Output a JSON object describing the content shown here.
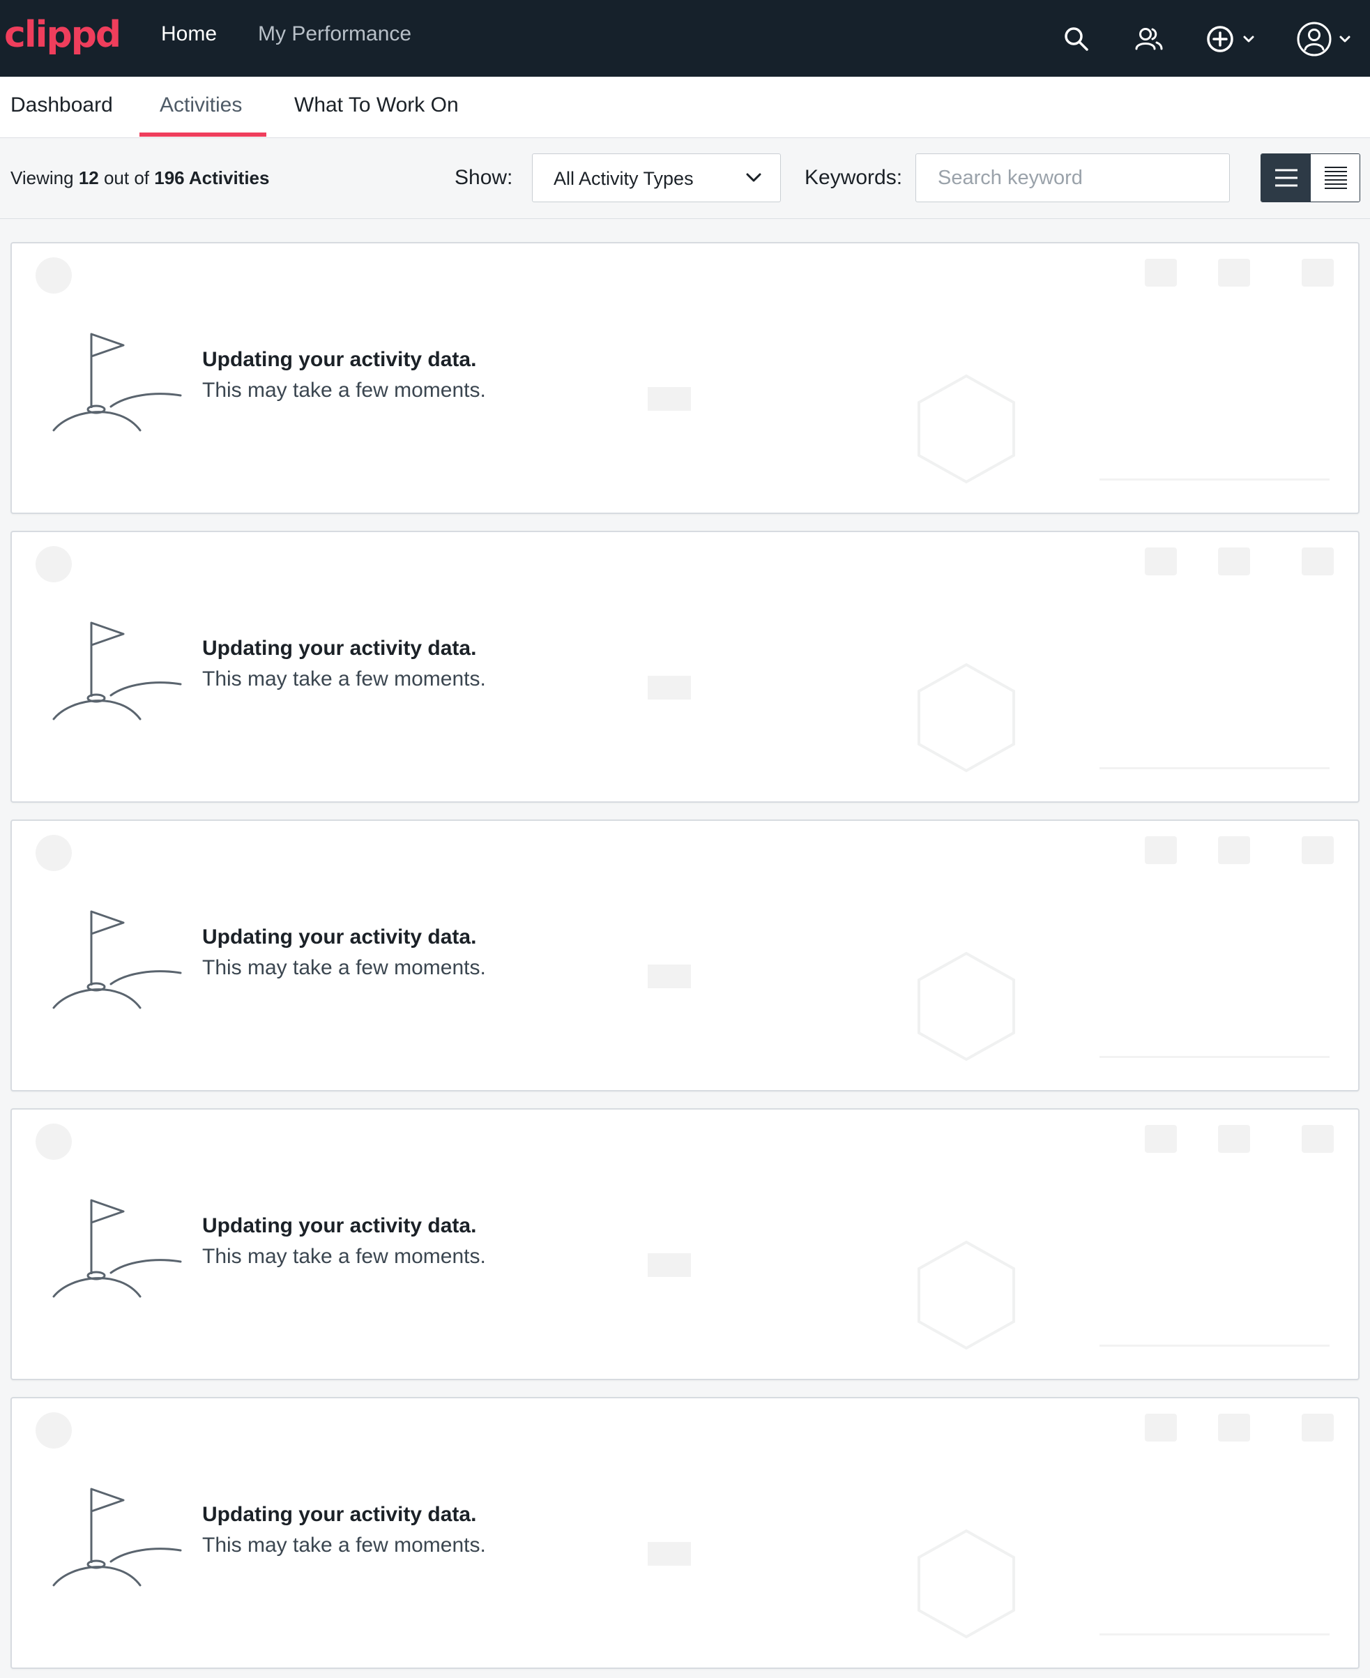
{
  "brand": {
    "logo_text": "clippd",
    "accent_color": "#ef3e5c",
    "nav_bg": "#16212b"
  },
  "topnav": {
    "links": [
      "Home",
      "My Performance"
    ],
    "icons": [
      "search-icon",
      "people-icon",
      "add-circle-icon",
      "chevron-down-icon",
      "user-avatar-icon",
      "chevron-down-icon"
    ]
  },
  "tabs": [
    "Dashboard",
    "Activities",
    "What To Work On"
  ],
  "active_tab": "Activities",
  "filter": {
    "viewing_prefix": "Viewing ",
    "viewing_count": "12",
    "viewing_mid": " out of ",
    "viewing_total": "196 Activities",
    "show_label": "Show:",
    "activity_type_selected": "All Activity Types",
    "keywords_label": "Keywords:",
    "search_placeholder": "Search keyword",
    "view_modes": [
      "list-view-icon",
      "compact-list-icon"
    ],
    "active_view": "list-view-icon"
  },
  "cards": [
    {
      "status_title": "Updating your activity data.",
      "status_subtitle": "This may take a few moments."
    },
    {
      "status_title": "Updating your activity data.",
      "status_subtitle": "This may take a few moments."
    },
    {
      "status_title": "Updating your activity data.",
      "status_subtitle": "This may take a few moments."
    },
    {
      "status_title": "Updating your activity data.",
      "status_subtitle": "This may take a few moments."
    },
    {
      "status_title": "Updating your activity data.",
      "status_subtitle": "This may take a few moments."
    }
  ]
}
